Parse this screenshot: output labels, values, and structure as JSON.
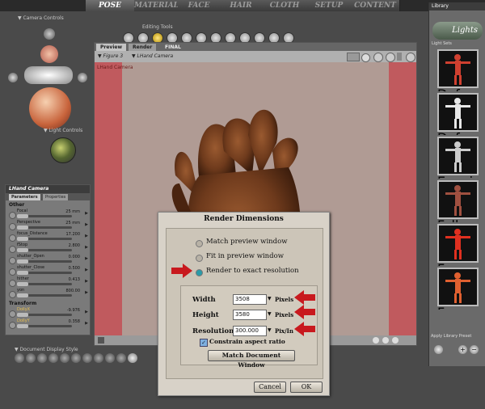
{
  "top_tabs": [
    "POSE",
    "MATERIAL",
    "FACE",
    "HAIR",
    "CLOTH",
    "SETUP",
    "CONTENT"
  ],
  "active_tab": "POSE",
  "left": {
    "camera_controls_label": "Camera Controls",
    "light_controls_label": "Light Controls",
    "document_display_style_label": "Document Display Style"
  },
  "editing_tools_label": "Editing Tools",
  "params_panel": {
    "title": "LHand Camera",
    "tabs": [
      "Parameters",
      "Properties"
    ],
    "sections": [
      {
        "name": "Other",
        "rows": [
          {
            "label": "Focal",
            "value": "25 mm"
          },
          {
            "label": "Perspective",
            "value": "25 mm"
          },
          {
            "label": "focus_Distance",
            "value": "17.200"
          },
          {
            "label": "fStop",
            "value": "2.800"
          },
          {
            "label": "shutter_Open",
            "value": "0.000"
          },
          {
            "label": "shutter_Close",
            "value": "0.500"
          },
          {
            "label": "hither",
            "value": "0.413"
          },
          {
            "label": "yon",
            "value": "800.00"
          }
        ]
      },
      {
        "name": "Transform",
        "rows": [
          {
            "label": "DollyX",
            "value": "-9.976"
          },
          {
            "label": "DollyY",
            "value": "0.358"
          }
        ]
      }
    ]
  },
  "doc": {
    "tabs": [
      "Preview",
      "Render"
    ],
    "final_label": "FINAL",
    "figure_dropdown": "Figure 3",
    "camera_dropdown": "LHand Camera",
    "canvas_label": "LHand Camera"
  },
  "library": {
    "header": "Library",
    "title": "Lights",
    "subheader": "Light Sets",
    "items": [
      "Default Lights 1",
      "Default Lights 2",
      "Evening Sun",
      "Fall",
      "Far From Home",
      "Far From Home"
    ],
    "footer": "Apply Library Preset"
  },
  "dialog": {
    "title": "Render Dimensions",
    "options": [
      "Match preview window",
      "Fit in preview window",
      "Render to exact resolution"
    ],
    "selected_option": 2,
    "width_label": "Width",
    "width_value": "3508",
    "width_unit": "Pixels",
    "height_label": "Height",
    "height_value": "3580",
    "height_unit": "Pixels",
    "resolution_label": "Resolution",
    "resolution_value": "300.000",
    "resolution_unit": "Pix/In",
    "constrain_label": "Constrain aspect ratio",
    "constrain_checked": true,
    "match_button": "Match Document Window",
    "cancel_button": "Cancel",
    "ok_button": "OK"
  },
  "colors": {
    "arrow_red": "#c8191e",
    "selected_radio": "#2a9aa8",
    "dialog_bg": "#d8d2c8"
  }
}
